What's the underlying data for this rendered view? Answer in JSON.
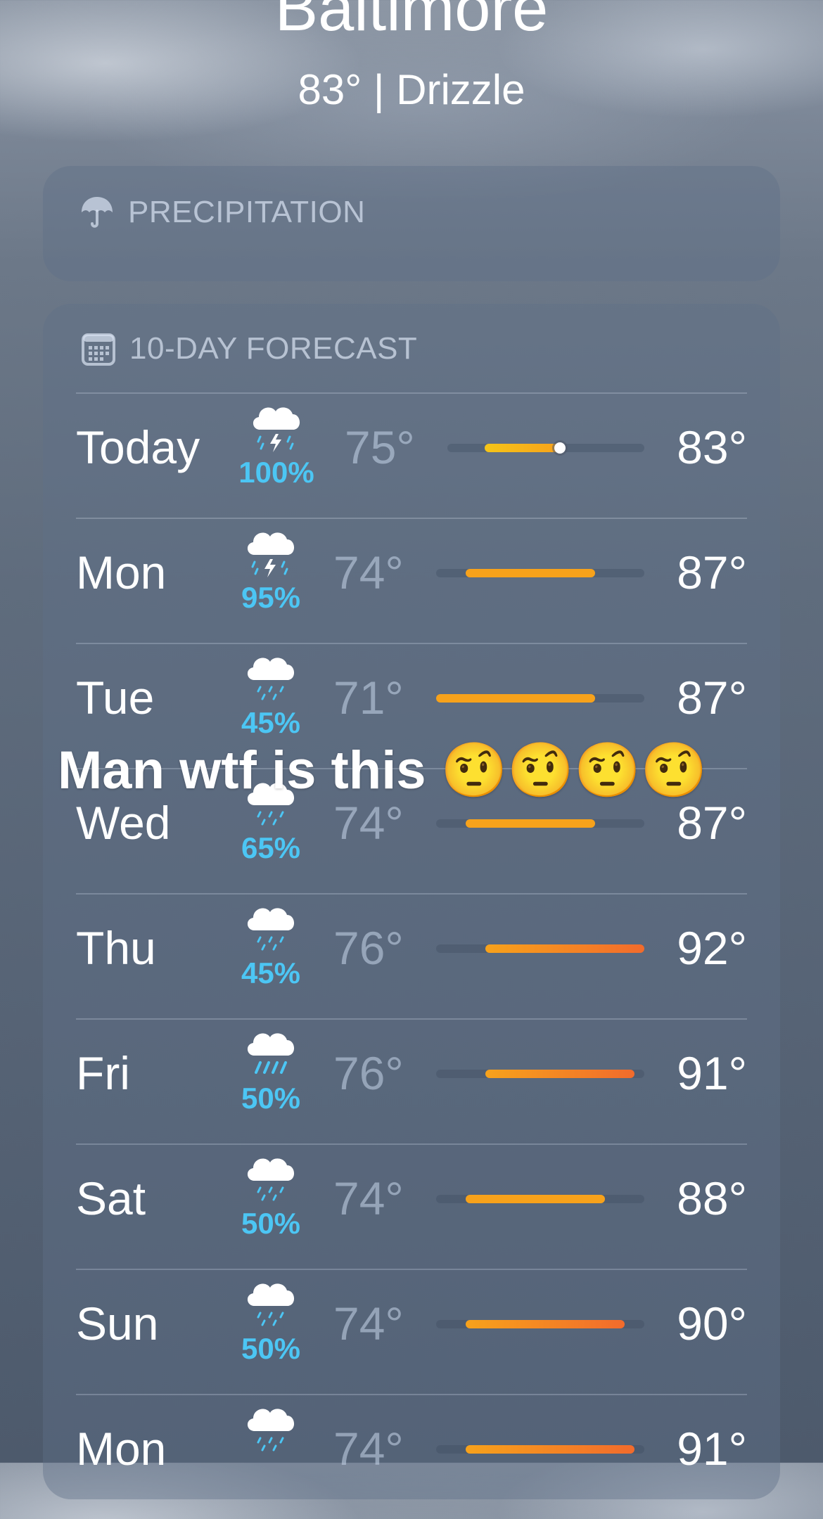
{
  "header": {
    "city": "Baltimore",
    "summary": "83° | Drizzle"
  },
  "precipitation_card": {
    "title": "PRECIPITATION",
    "icon": "umbrella-icon"
  },
  "forecast_card": {
    "title": "10-DAY FORECAST",
    "icon": "calendar-icon",
    "scale": {
      "min": 71,
      "max": 92
    },
    "colors": {
      "precip_text": "#4cc6f4",
      "bar_cool": "#f5c518",
      "bar_warm": "#f7a21b",
      "bar_hot": "#f26b2c"
    },
    "days": [
      {
        "day": "Today",
        "icon": "cloud-thunderstorm-icon",
        "precip": "100%",
        "low": "75°",
        "high": "83°",
        "low_val": 75,
        "high_val": 83,
        "current": 83
      },
      {
        "day": "Mon",
        "icon": "cloud-thunderstorm-icon",
        "precip": "95%",
        "low": "74°",
        "high": "87°",
        "low_val": 74,
        "high_val": 87
      },
      {
        "day": "Tue",
        "icon": "cloud-rain-icon",
        "precip": "45%",
        "low": "71°",
        "high": "87°",
        "low_val": 71,
        "high_val": 87
      },
      {
        "day": "Wed",
        "icon": "cloud-rain-icon",
        "precip": "65%",
        "low": "74°",
        "high": "87°",
        "low_val": 74,
        "high_val": 87
      },
      {
        "day": "Thu",
        "icon": "cloud-rain-icon",
        "precip": "45%",
        "low": "76°",
        "high": "92°",
        "low_val": 76,
        "high_val": 92
      },
      {
        "day": "Fri",
        "icon": "cloud-heavy-rain-icon",
        "precip": "50%",
        "low": "76°",
        "high": "91°",
        "low_val": 76,
        "high_val": 91
      },
      {
        "day": "Sat",
        "icon": "cloud-rain-icon",
        "precip": "50%",
        "low": "74°",
        "high": "88°",
        "low_val": 74,
        "high_val": 88
      },
      {
        "day": "Sun",
        "icon": "cloud-rain-icon",
        "precip": "50%",
        "low": "74°",
        "high": "90°",
        "low_val": 74,
        "high_val": 90
      },
      {
        "day": "Mon",
        "icon": "cloud-rain-icon",
        "precip": "",
        "low": "74°",
        "high": "91°",
        "low_val": 74,
        "high_val": 91
      }
    ]
  },
  "overlay": {
    "caption": "Man wtf is this 🤨🤨🤨🤨"
  }
}
